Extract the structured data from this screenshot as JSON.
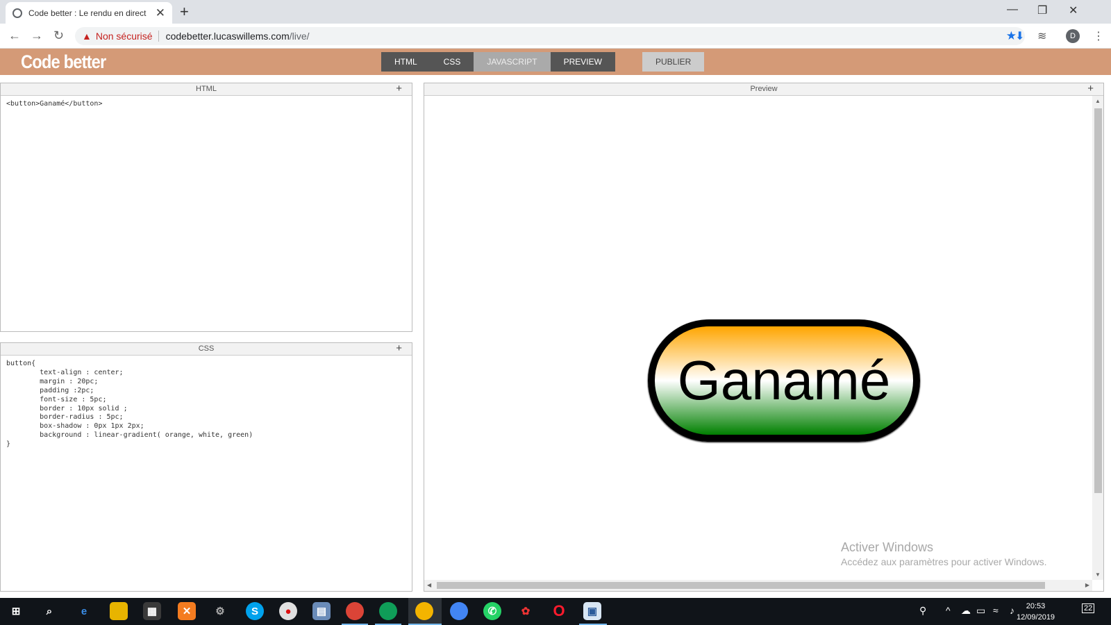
{
  "browser": {
    "tab_title": "Code better : Le rendu en direct",
    "new_tab": "+",
    "close": "✕",
    "security_label": "Non sécurisé",
    "url_host": "codebetter.lucaswillems.com",
    "url_path": "/live/",
    "profile_initial": "D"
  },
  "site": {
    "logo": "Code better",
    "tabs": [
      {
        "label": "HTML"
      },
      {
        "label": "CSS"
      },
      {
        "label": "JAVASCRIPT"
      },
      {
        "label": "PREVIEW"
      }
    ],
    "publish_label": "PUBLIER"
  },
  "panels": {
    "html": {
      "title": "HTML",
      "add": "+",
      "code": "<button>Ganamé</button>"
    },
    "css": {
      "title": "CSS",
      "add": "+",
      "code": "button{\n        text-align : center;\n        margin : 20pc;\n        padding :2pc;\n        font-size : 5pc;\n        border : 10px solid ;\n        border-radius : 5pc;\n        box-shadow : 0px 1px 2px;\n        background : linear-gradient( orange, white, green)\n}"
    },
    "preview": {
      "title": "Preview",
      "add": "+",
      "button_label": "Ganamé"
    }
  },
  "watermark": {
    "title": "Activer Windows",
    "subtitle": "Accédez aux paramètres pour activer Windows."
  },
  "taskbar": {
    "time": "20:53",
    "date": "12/09/2019",
    "notifications": "22"
  },
  "colors": {
    "header": "#d49a77",
    "nav_tab": "#555555",
    "nav_tab_active": "#aaaaaa",
    "taskbar": "#101419"
  }
}
